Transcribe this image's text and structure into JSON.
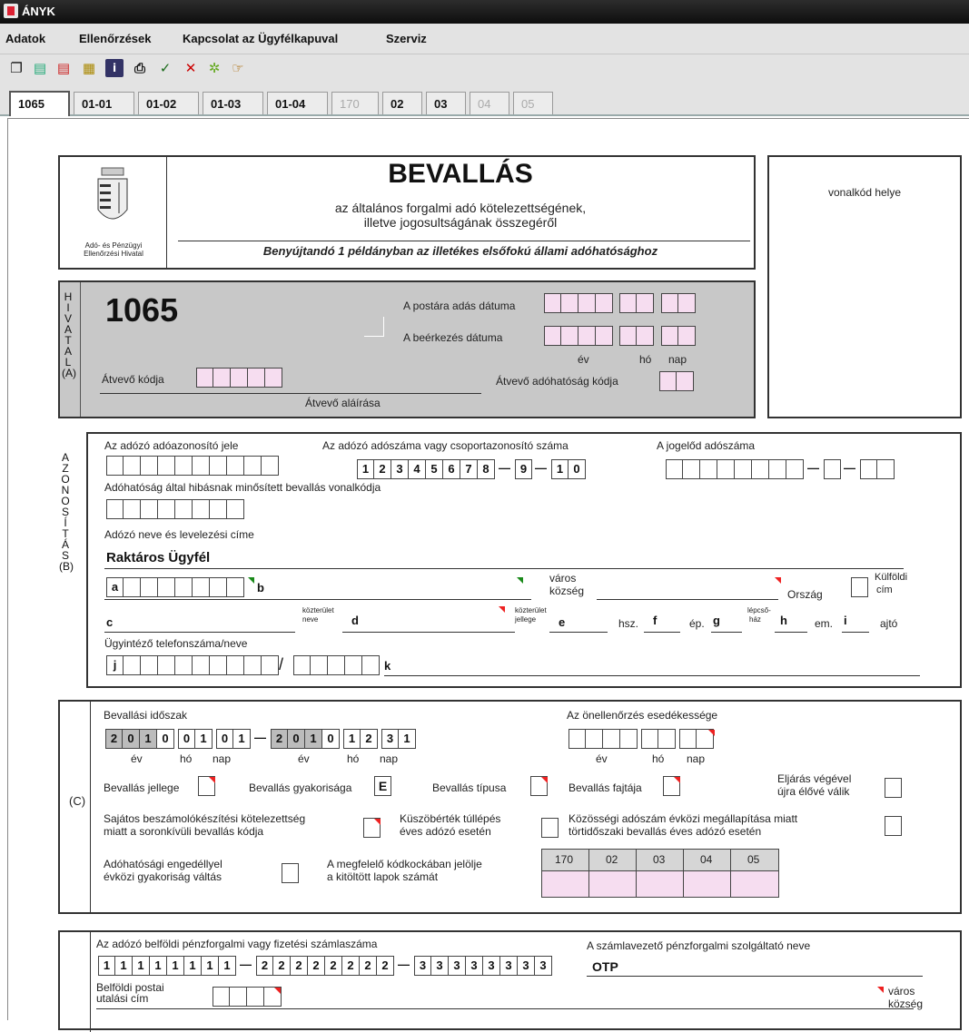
{
  "window": {
    "title": "ÁNYK"
  },
  "menu": [
    "Adatok",
    "Ellenőrzések",
    "Kapcsolat az Ügyfélkapuval",
    "Szerviz"
  ],
  "toolbar": {
    "icons": [
      "copy-icon",
      "save-icon",
      "save-as-icon",
      "print-preview-icon",
      "info-icon",
      "print-icon",
      "check-icon",
      "delete-icon",
      "calculate-icon",
      "next-icon"
    ]
  },
  "tabs": [
    {
      "label": "1065",
      "active": true
    },
    {
      "label": "01-01"
    },
    {
      "label": "01-02"
    },
    {
      "label": "01-03"
    },
    {
      "label": "01-04"
    },
    {
      "label": "170",
      "disabled": true
    },
    {
      "label": "02"
    },
    {
      "label": "03"
    },
    {
      "label": "04",
      "disabled": true
    },
    {
      "label": "05",
      "disabled": true
    }
  ],
  "header": {
    "title": "BEVALLÁS",
    "subtitle1": "az általános forgalmi adó kötelezettségének,",
    "subtitle2": "illetve jogosultságának összegéről",
    "submit_note": "Benyújtandó 1 példányban az illetékes elsőfokú állami adóhatósághoz",
    "agency1": "Adó- és Pénzügyi",
    "agency2": "Ellenőrzési Hivatal",
    "barcode": "vonalkód helye"
  },
  "office": {
    "vert": "H\nI\nV\nA\nT\nA\nL\n(A)",
    "code": "1065",
    "post_date": "A postára adás dátuma",
    "arrival_date": "A beérkezés dátuma",
    "ev": "év",
    "ho": "hó",
    "nap": "nap",
    "receiver_code": "Átvevő kódja",
    "receiver_sign": "Átvevő aláírása",
    "tax_code": "Átvevő adóhatóság kódja"
  },
  "ident": {
    "vert": "A\nZ\nO\nN\nO\nS\nÍ\nT\nÁ\nS\n(B)",
    "tax_id": "Az adózó adóazonosító jele",
    "tax_number": "Az adózó adószáma vagy csoportazonosító száma",
    "tax_number_digits": [
      "1",
      "2",
      "3",
      "4",
      "5",
      "6",
      "7",
      "8"
    ],
    "tax_number_d9": "9",
    "tax_number_d10": [
      "1",
      "0"
    ],
    "predecessor": "A jogelőd adószáma",
    "faulty_barcode": "Adóhatóság által hibásnak minősített bevallás vonalkódja",
    "name_addr": "Adózó neve és levelezési címe",
    "name": "Raktáros Ügyfél",
    "a": "a",
    "b": "b",
    "c": "c",
    "d": "d",
    "e": "e",
    "f": "f",
    "g": "g",
    "h": "h",
    "i": "i",
    "j": "j",
    "k": "k",
    "varos": "város",
    "kozseg": "község",
    "orszag": "Ország",
    "kulfoldi": "Külföldi",
    "cim": "cím",
    "kozterulet": "közterület",
    "neve": "neve",
    "jellege": "jellege",
    "hsz": "hsz.",
    "ep": "ép.",
    "lepcso": "lépcső-",
    "haz": "ház",
    "em": "em.",
    "ajto": "ajtó",
    "phone": "Ügyintéző telefonszáma/neve"
  },
  "period": {
    "label_c": "(C)",
    "period_label": "Bevallási időszak",
    "from": [
      "2",
      "0",
      "1",
      "0",
      "0",
      "1",
      "0",
      "1"
    ],
    "to": [
      "2",
      "0",
      "1",
      "0",
      "1",
      "2",
      "3",
      "1"
    ],
    "ev": "év",
    "ho": "hó",
    "nap": "nap",
    "self_check": "Az önellenőrzés esedékessége",
    "jelleg": "Bevallás jellege",
    "gyakorisag": "Bevallás gyakorisága",
    "gyakorisag_val": "E",
    "tipus": "Bevallás típusa",
    "fajta": "Bevallás fajtája",
    "eljaras1": "Eljárás végével",
    "eljaras2": "újra élővé válik",
    "sajatos1": "Sajátos beszámolókészítési kötelezettség",
    "sajatos2": "miatt a soronkívüli bevallás kódja",
    "kuszob1": "Küszöbérték túllépés",
    "kuszob2": "éves adózó esetén",
    "kozossegi1": "Közösségi adószám évközi megállapítása miatt",
    "kozossegi2": "törtidőszaki bevallás éves adózó esetén",
    "engedely1": "Adóhatósági engedéllyel",
    "engedely2": "évközi gyakoriság váltás",
    "kodkocka1": "A megfelelő kódkockában jelölje",
    "kodkocka2": "a kitöltött lapok számát",
    "pages": [
      "170",
      "02",
      "03",
      "04",
      "05"
    ]
  },
  "bank": {
    "account_label": "Az adózó belföldi pénzforgalmi vagy fizetési számlaszáma",
    "acc1": [
      "1",
      "1",
      "1",
      "1",
      "1",
      "1",
      "1",
      "1"
    ],
    "acc2": [
      "2",
      "2",
      "2",
      "2",
      "2",
      "2",
      "2",
      "2"
    ],
    "acc3": [
      "3",
      "3",
      "3",
      "3",
      "3",
      "3",
      "3",
      "3"
    ],
    "provider_label": "A számlavezető pénzforgalmi szolgáltató neve",
    "provider": "OTP",
    "postal1": "Belföldi postai",
    "postal2": "utalási cím",
    "varos": "város",
    "kozseg": "község"
  },
  "colors": {
    "pink": "#f6ddf0",
    "gray": "#bcbcbc",
    "office_bg": "#c8c8c8",
    "red_marker": "#e22",
    "green_marker": "#1a8a1a"
  }
}
